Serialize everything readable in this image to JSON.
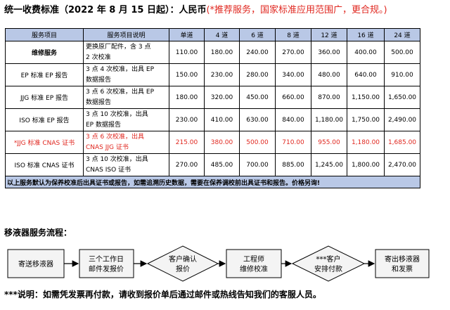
{
  "header": {
    "title_main": "统一收费标准（2022 年 8 月 15 日起）：人民币",
    "title_note": "(*推荐服务，国家标准应用范围广，更合规。)"
  },
  "table": {
    "columns": [
      "服务项目",
      "服务项目说明",
      "单道",
      "4 道",
      "6 道",
      "8 道",
      "12 道",
      "16 道",
      "24 道"
    ],
    "rows": [
      {
        "item": "维修服务",
        "desc": [
          "更换原厂配件，含 3 点",
          "2 次校准"
        ],
        "prices": [
          "110.00",
          "180.00",
          "240.00",
          "270.00",
          "360.00",
          "400.00",
          "500.00"
        ]
      },
      {
        "item": "EP 标准 EP 报告",
        "desc": [
          "3 点 4 次校准，出具 EP",
          "数据报告"
        ],
        "prices": [
          "150.00",
          "230.00",
          "280.00",
          "340.00",
          "480.00",
          "640.00",
          "910.00"
        ]
      },
      {
        "item": "JJG 标准 EP 报告",
        "desc": [
          "3 点 6 次校准，出具 EP",
          "数据报告"
        ],
        "prices": [
          "180.00",
          "320.00",
          "450.00",
          "660.00",
          "870.00",
          "1,150.00",
          "1,650.00"
        ]
      },
      {
        "item": "ISO 标准 EP 报告",
        "desc": [
          "3 点 10 次校准，出具",
          "EP 数据报告"
        ],
        "prices": [
          "230.00",
          "410.00",
          "630.00",
          "840.00",
          "1,180.00",
          "1,750.00",
          "2,490.00"
        ]
      },
      {
        "item": "*JJG 标准 CNAS 证书",
        "desc": [
          "3 点 6 次校准，出具",
          "CNAS JJG 证书"
        ],
        "prices": [
          "215.00",
          "380.00",
          "500.00",
          "710.00",
          "955.00",
          "1,180.00",
          "1,685.00"
        ]
      },
      {
        "item": "ISO 标准 CNAS 证书",
        "desc": [
          "3 点 10 次校准，出具",
          "CNAS ISO 证书"
        ],
        "prices": [
          "270.00",
          "485.00",
          "700.00",
          "885.00",
          "1,245.00",
          "1,800.00",
          "2,470.00"
        ]
      }
    ],
    "note": "以上服务默认为保养校准后出具证书或报告，如需追溯历史数据，需要在保养调校前出具证书和报告。价格另询!"
  },
  "flow": {
    "title": "移液器服务流程：",
    "steps": [
      {
        "line1": "寄送移液器"
      },
      {
        "line1": "三个工作日",
        "line2": "邮件发报价"
      },
      {
        "line1": "客户确认",
        "line2": "报价"
      },
      {
        "line1": "工程师",
        "line2": "维修校准"
      },
      {
        "line1": "***客户",
        "line2": "安排付款"
      },
      {
        "line1": "寄出移液器",
        "line2": "和发票"
      }
    ]
  },
  "footer": {
    "note": "***说明：如需凭发票再付款，请收到报价单后通过邮件或热线告知我们的客服人员。"
  },
  "colors": {
    "header_bg": "#b9c8e6",
    "accent_red": "#e0271f",
    "box_bg": "#f4f4f4"
  }
}
